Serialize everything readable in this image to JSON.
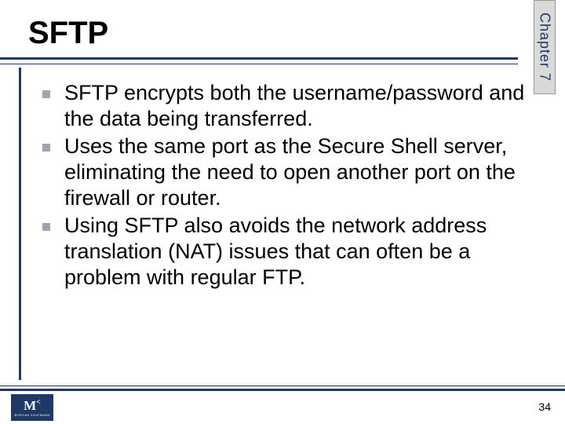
{
  "chapter_label": "Chapter 7",
  "title": "SFTP",
  "bullets": [
    "SFTP encrypts both the username/password and the data being transferred.",
    "Uses the same port as the Secure Shell server, eliminating the need to open another port on the firewall or router.",
    "Using SFTP also avoids the network address translation (NAT) issues that can often be a problem with regular FTP."
  ],
  "logo": {
    "main": "MK",
    "sub": "MORGAN KAUFMANN"
  },
  "page_number": "34"
}
